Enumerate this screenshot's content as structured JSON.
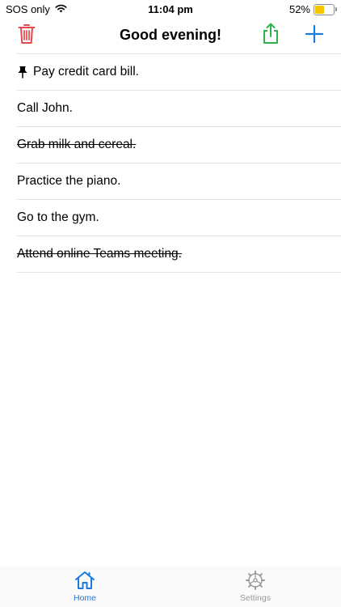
{
  "status_bar": {
    "carrier": "SOS only",
    "time": "11:04 pm",
    "battery": "52%",
    "battery_level": 0.52,
    "icons": [
      "wifi-icon",
      "battery-icon"
    ]
  },
  "nav": {
    "title": "Good evening!",
    "icons": [
      "trash-icon",
      "share-icon",
      "plus-icon"
    ]
  },
  "todos": [
    {
      "label": "Pay credit card bill.",
      "pinned": true,
      "done": false
    },
    {
      "label": "Call John.",
      "pinned": false,
      "done": false
    },
    {
      "label": "Grab milk and cereal.",
      "pinned": false,
      "done": true
    },
    {
      "label": "Practice the piano.",
      "pinned": false,
      "done": false
    },
    {
      "label": "Go to the gym.",
      "pinned": false,
      "done": false
    },
    {
      "label": "Attend online Teams meeting.",
      "pinned": false,
      "done": true
    }
  ],
  "tab_bar": {
    "tabs": [
      {
        "label": "Home",
        "icon": "house-icon",
        "selected": true
      },
      {
        "label": "Settings",
        "icon": "gear-icon",
        "selected": false
      }
    ]
  },
  "colors": {
    "accent": "#1b7be0",
    "trash": "#e5484d",
    "share": "#2db34a",
    "battery_fill": "#f7c500",
    "inactive_tab": "#9a9a9e"
  }
}
